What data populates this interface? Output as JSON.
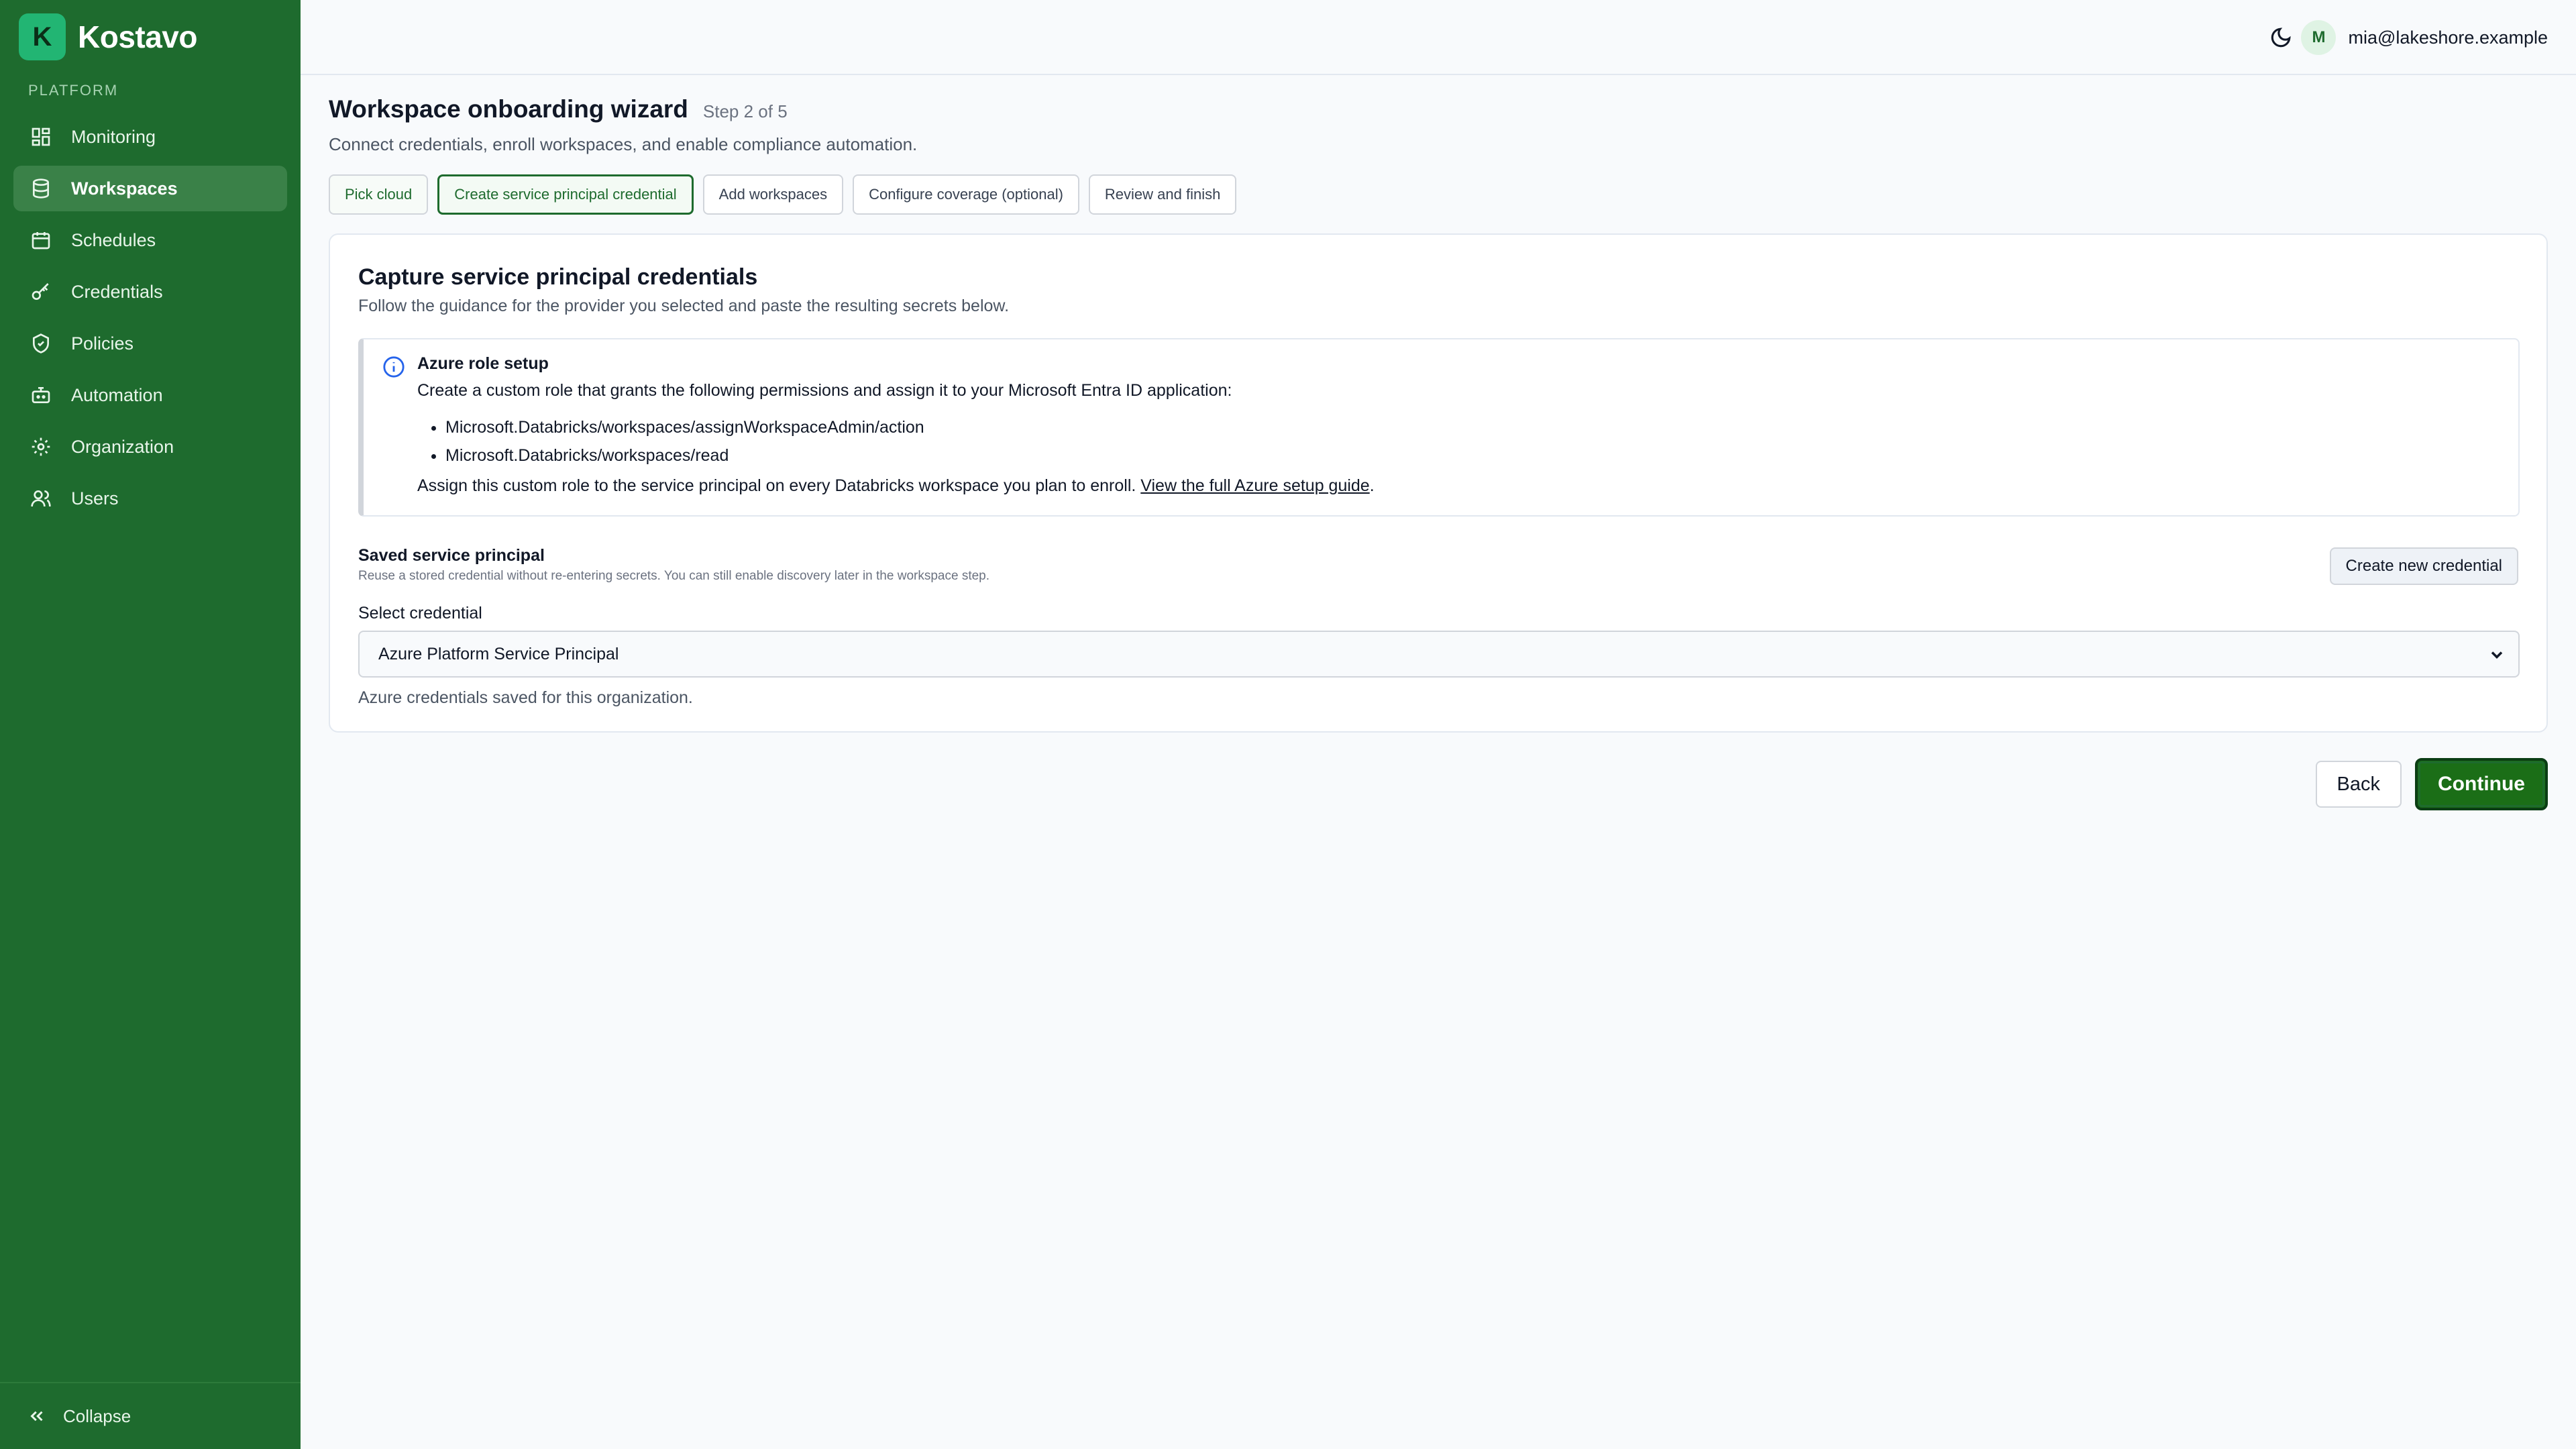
{
  "brand": {
    "logo_letter": "K",
    "name": "Kostavo"
  },
  "sidebar": {
    "section_label": "PLATFORM",
    "items": [
      {
        "label": "Monitoring",
        "icon": "dashboard-icon",
        "active": false
      },
      {
        "label": "Workspaces",
        "icon": "database-icon",
        "active": true
      },
      {
        "label": "Schedules",
        "icon": "calendar-icon",
        "active": false
      },
      {
        "label": "Credentials",
        "icon": "key-icon",
        "active": false
      },
      {
        "label": "Policies",
        "icon": "shield-icon",
        "active": false
      },
      {
        "label": "Automation",
        "icon": "bot-icon",
        "active": false
      },
      {
        "label": "Organization",
        "icon": "gear-icon",
        "active": false
      },
      {
        "label": "Users",
        "icon": "users-icon",
        "active": false
      }
    ],
    "collapse_label": "Collapse"
  },
  "topbar": {
    "theme_icon": "moon-icon",
    "user_initial": "M",
    "user_email": "mia@lakeshore.example"
  },
  "page": {
    "title": "Workspace onboarding wizard",
    "step_label": "Step 2 of 5",
    "subtitle": "Connect credentials, enroll workspaces, and enable compliance automation."
  },
  "steps": [
    {
      "label": "Pick cloud",
      "state": "done"
    },
    {
      "label": "Create service principal credential",
      "state": "current"
    },
    {
      "label": "Add workspaces",
      "state": "upcoming"
    },
    {
      "label": "Configure coverage (optional)",
      "state": "upcoming"
    },
    {
      "label": "Review and finish",
      "state": "upcoming"
    }
  ],
  "card": {
    "title": "Capture service principal credentials",
    "subtitle": "Follow the guidance for the provider you selected and paste the resulting secrets below.",
    "info": {
      "title": "Azure role setup",
      "text": "Create a custom role that grants the following permissions and assign it to your Microsoft Entra ID application:",
      "permissions": [
        "Microsoft.Databricks/workspaces/assignWorkspaceAdmin/action",
        "Microsoft.Databricks/workspaces/read"
      ],
      "footer_text": "Assign this custom role to the service principal on every Databricks workspace you plan to enroll. ",
      "footer_link": "View the full Azure setup guide",
      "footer_end": "."
    },
    "saved": {
      "title": "Saved service principal",
      "subtitle": "Reuse a stored credential without re-entering secrets. You can still enable discovery later in the workspace step.",
      "new_button": "Create new credential",
      "select_label": "Select credential",
      "selected_value": "Azure Platform Service Principal",
      "help": "Azure credentials saved for this organization."
    }
  },
  "actions": {
    "back": "Back",
    "continue": "Continue"
  },
  "colors": {
    "sidebar": "#1e6b2e",
    "accent": "#1e6b2e",
    "info_icon": "#2563eb"
  }
}
